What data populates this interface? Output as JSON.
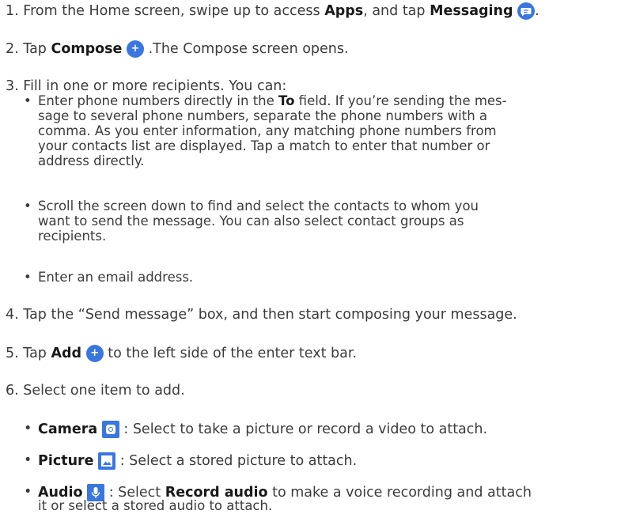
{
  "steps": {
    "s1": {
      "num": "1.",
      "pre": "From the Home screen, swipe up to access ",
      "apps": "Apps",
      "mid": ", and tap ",
      "messaging": "Messaging",
      "post": "."
    },
    "s2": {
      "num": "2.",
      "pre": "Tap ",
      "compose": "Compose",
      "post": ".The Compose screen opens."
    },
    "s3": {
      "num": "3.",
      "text": "Fill in one or more recipients. You can:"
    },
    "s3a": {
      "l1a": "Enter phone numbers directly in the ",
      "to": "To",
      "l1b": " field. If you’re sending the mes-",
      "l2": "sage to several phone numbers, separate the phone numbers with a",
      "l3": "comma. As you enter information, any matching phone numbers from",
      "l4": "your contacts list are displayed. Tap a match to enter that number or",
      "l5": "address directly."
    },
    "s3b": {
      "l1": "Scroll the screen down to find and select the contacts to whom you",
      "l2": "want to send the message. You can also select contact groups as",
      "l3": "recipients."
    },
    "s3c": {
      "l1": "Enter an email address."
    },
    "s4": {
      "num": "4.",
      "text": "Tap the “Send message” box, and then start composing your message."
    },
    "s5": {
      "num": "5.",
      "pre": "Tap ",
      "add": "Add",
      "post": " to the left side of the enter text bar."
    },
    "s6": {
      "num": "6.",
      "text": "Select one item to add."
    },
    "s6a": {
      "label": "Camera",
      "post": ": Select to take a picture or record a video to attach."
    },
    "s6b": {
      "label": "Picture",
      "post": ": Select a stored picture to attach."
    },
    "s6c": {
      "label": "Audio",
      "mid": ": Select ",
      "rec": "Record audio",
      "post": " to make a voice recording and attach",
      "l2": "it or select a stored audio to attach."
    },
    "bullet": "•"
  },
  "icons": {
    "messaging": "messaging-bubble-icon",
    "compose": "plus-circle-icon",
    "add": "plus-circle-icon",
    "camera": "camera-icon",
    "picture": "picture-icon",
    "audio": "microphone-icon"
  },
  "colors": {
    "accent": "#3a76e0",
    "text": "#3b3b3b"
  }
}
